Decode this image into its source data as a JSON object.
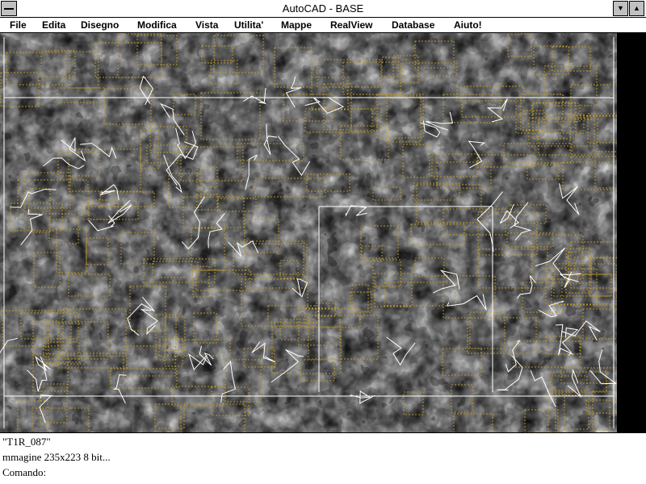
{
  "window": {
    "title": "AutoCAD - BASE",
    "minimize_glyph": "▼",
    "maximize_glyph": "▲"
  },
  "menu": [
    {
      "label": "File"
    },
    {
      "label": "Edita"
    },
    {
      "label": "Disegno"
    },
    {
      "label": "Modifica"
    },
    {
      "label": "Vista"
    },
    {
      "label": "Utilita'"
    },
    {
      "label": "Mappe"
    },
    {
      "label": "RealView"
    },
    {
      "label": "Database"
    },
    {
      "label": "Aiuto!"
    }
  ],
  "drawing": {
    "description_icon": "raster-image-with-vector-overlay",
    "overlay_color": "#b8962e",
    "vector_color": "#ffffff"
  },
  "command": {
    "line1": "\"T1R_087\"",
    "line2": "mmagine 235x223 8 bit...",
    "line3": "Comando:"
  }
}
